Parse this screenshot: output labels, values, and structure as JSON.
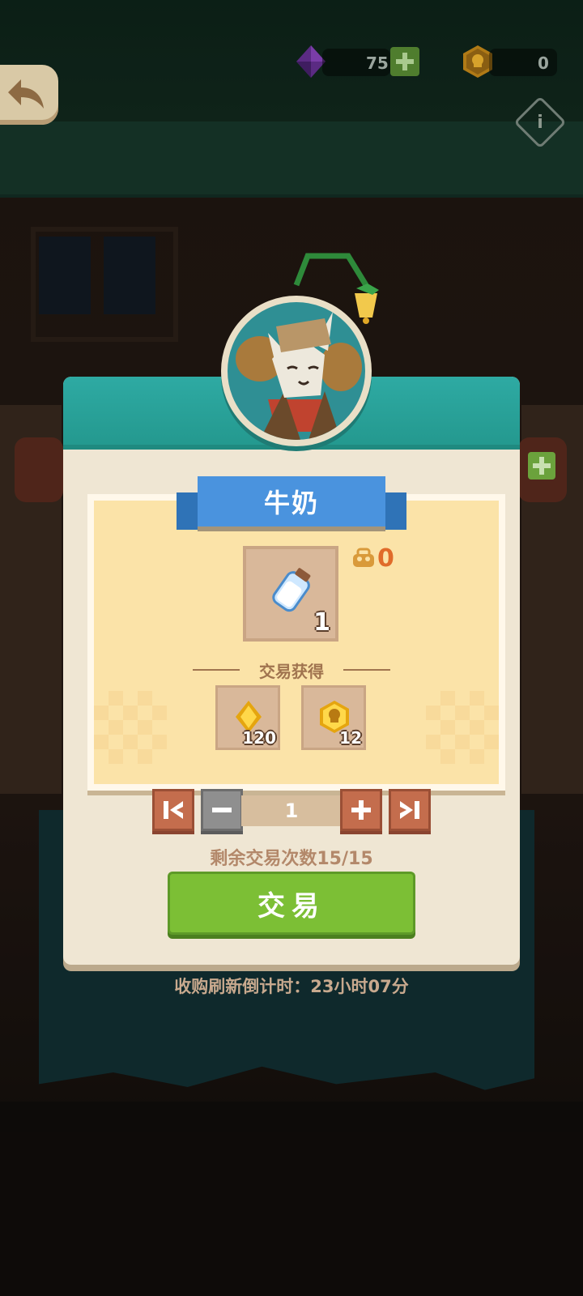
{
  "hud": {
    "gems": "75",
    "coins": "0"
  },
  "dialog": {
    "title": "牛奶",
    "item_quantity": "1",
    "owned_count": "0",
    "reward_title": "交易获得",
    "rewards": [
      {
        "icon": "gold-diamond-coin-icon",
        "amount": "120"
      },
      {
        "icon": "skull-coin-icon",
        "amount": "12"
      }
    ],
    "stepper_value": "1",
    "remaining": "剩余交易次数15/15",
    "trade_label": "交易"
  },
  "countdown": "收购刷新倒计时：23小时07分",
  "colors": {
    "header_teal": "#2eaaa3",
    "ribbon_blue": "#4a93de",
    "trade_green": "#7cbf35",
    "stepper_brown": "#c46d4d",
    "owned_orange": "#e06b2a"
  }
}
